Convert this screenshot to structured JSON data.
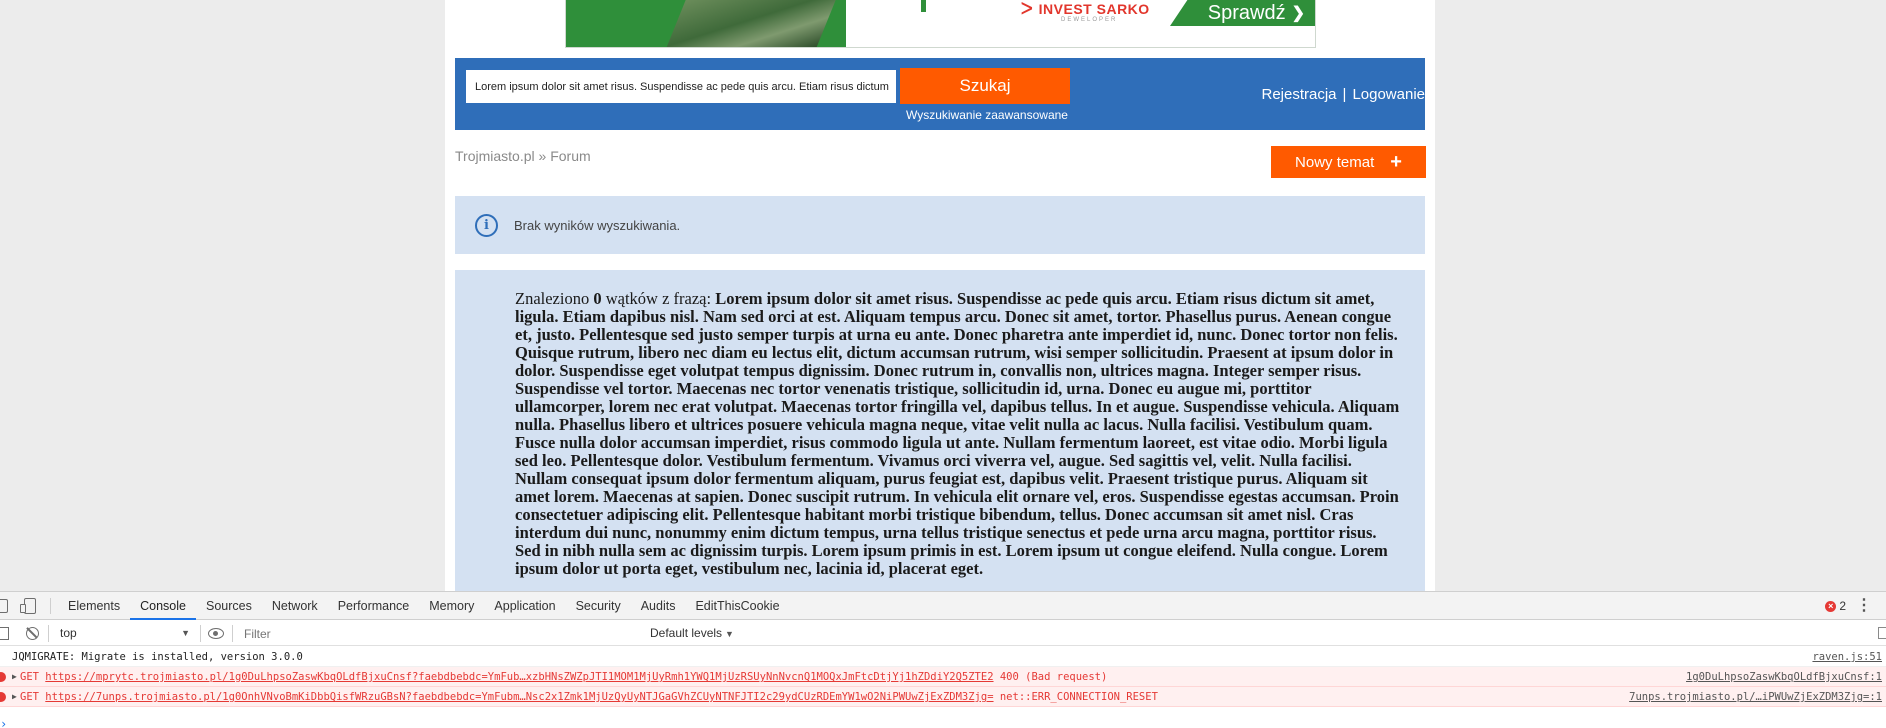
{
  "ad": {
    "brand_name": "INVEST SARKO",
    "brand_sub": "DEWELOPER",
    "cta_label": "Sprawdź",
    "cta_arrow": "❯"
  },
  "search": {
    "input_value": "Lorem ipsum dolor sit amet risus. Suspendisse ac pede quis arcu. Etiam risus dictum",
    "button_label": "Szukaj",
    "advanced_label": "Wyszukiwanie zaawansowane"
  },
  "auth": {
    "register_label": "Rejestracja",
    "separator": "|",
    "login_label": "Logowanie"
  },
  "breadcrumb": {
    "home": "Trojmiasto.pl",
    "separator": " » ",
    "current": "Forum"
  },
  "new_topic": {
    "label": "Nowy temat",
    "icon": "+"
  },
  "info": {
    "icon": "i",
    "message": "Brak wyników wyszukiwania."
  },
  "results": {
    "prefix": "Znaleziono ",
    "count": "0",
    "middle": " wątków z frazą: ",
    "query": "Lorem ipsum dolor sit amet risus. Suspendisse ac pede quis arcu. Etiam risus dictum sit amet, ligula. Etiam dapibus nisl. Nam sed orci at est. Aliquam tempus arcu. Donec sit amet, tortor. Phasellus purus. Aenean congue et, justo. Pellentesque sed justo semper turpis at urna eu ante. Donec pharetra ante imperdiet id, nunc. Donec tortor non felis. Quisque rutrum, libero nec diam eu lectus elit, dictum accumsan rutrum, wisi semper sollicitudin. Praesent at ipsum dolor in dolor. Suspendisse eget volutpat tempus dignissim. Donec rutrum in, convallis non, ultrices magna. Integer semper risus. Suspendisse vel tortor. Maecenas nec tortor venenatis tristique, sollicitudin id, urna. Donec eu augue mi, porttitor ullamcorper, lorem nec erat volutpat. Maecenas tortor fringilla vel, dapibus tellus. In et augue. Suspendisse vehicula. Aliquam nulla. Phasellus libero et ultrices posuere vehicula magna neque, vitae velit nulla ac lacus. Nulla facilisi. Vestibulum quam. Fusce nulla dolor accumsan imperdiet, risus commodo ligula ut ante. Nullam fermentum laoreet, est vitae odio. Morbi ligula sed leo. Pellentesque dolor. Vestibulum fermentum. Vivamus orci viverra vel, augue. Sed sagittis vel, velit. Nulla facilisi. Nullam consequat ipsum dolor fermentum aliquam, purus feugiat est, dapibus velit. Praesent tristique purus. Aliquam sit amet lorem. Maecenas at sapien. Donec suscipit rutrum. In vehicula elit ornare vel, eros. Suspendisse egestas accumsan. Proin consectetuer adipiscing elit. Pellentesque habitant morbi tristique bibendum, tellus. Donec accumsan sit amet nisl. Cras interdum dui nunc, nonummy enim dictum tempus, urna tellus tristique senectus et pede urna arcu magna, porttitor risus. Sed in nibh nulla sem ac dignissim turpis. Lorem ipsum primis in est. Lorem ipsum ut congue eleifend. Nulla congue. Lorem ipsum dolor ut porta eget, vestibulum nec, lacinia id, placerat eget."
  },
  "devtools": {
    "tabs": [
      "Elements",
      "Console",
      "Sources",
      "Network",
      "Performance",
      "Memory",
      "Application",
      "Security",
      "Audits",
      "EditThisCookie"
    ],
    "active_tab": "Console",
    "error_count": "2",
    "menu_icon": "⋮",
    "context": "top",
    "context_caret": "▼",
    "filter_placeholder": "Filter",
    "levels_label": "Default levels",
    "levels_caret": "▼",
    "prompt": "›",
    "logs": [
      {
        "type": "info",
        "message": "JQMIGRATE: Migrate is installed, version 3.0.0",
        "source": "raven.js:51"
      },
      {
        "type": "error",
        "method": "GET",
        "url": "https://mprytc.trojmiasto.pl/1g0DuLhpsoZaswKbqOLdfBjxuCnsf?faebdbebdc=YmFub…xzbHNsZWZpJTI1MOM1MjUyRmh1YWQ1MjUzRSUyNnNvcnQ1MOQxJmFtcDtjYj1hZDdiY2Q5ZTE2",
        "status": "400 (Bad request)",
        "source": "1g0DuLhpsoZaswKbqOLdfBjxuCnsf:1"
      },
      {
        "type": "error",
        "method": "GET",
        "url": "https://7unps.trojmiasto.pl/1g0OnhVNvoBmKiDbbQisfWRzuGBsN?faebdbebdc=YmFubm…Nsc2x1Zmk1MjUzQyUyNTJGaGVhZCUyNTNFJTI2c29ydCUzRDEmYW1wO2NiPWUwZjExZDM3Zjg=",
        "status": "net::ERR_CONNECTION_RESET",
        "source": "7unps.trojmiasto.pl/…iPWUwZjExZDM3Zjg=:1"
      }
    ]
  },
  "colors": {
    "brand_blue": "#2f6eb9",
    "accent_orange": "#ff5a00",
    "info_bg": "#d4e1f2",
    "ad_green": "#2f8f3a",
    "error_red": "#e53935"
  }
}
